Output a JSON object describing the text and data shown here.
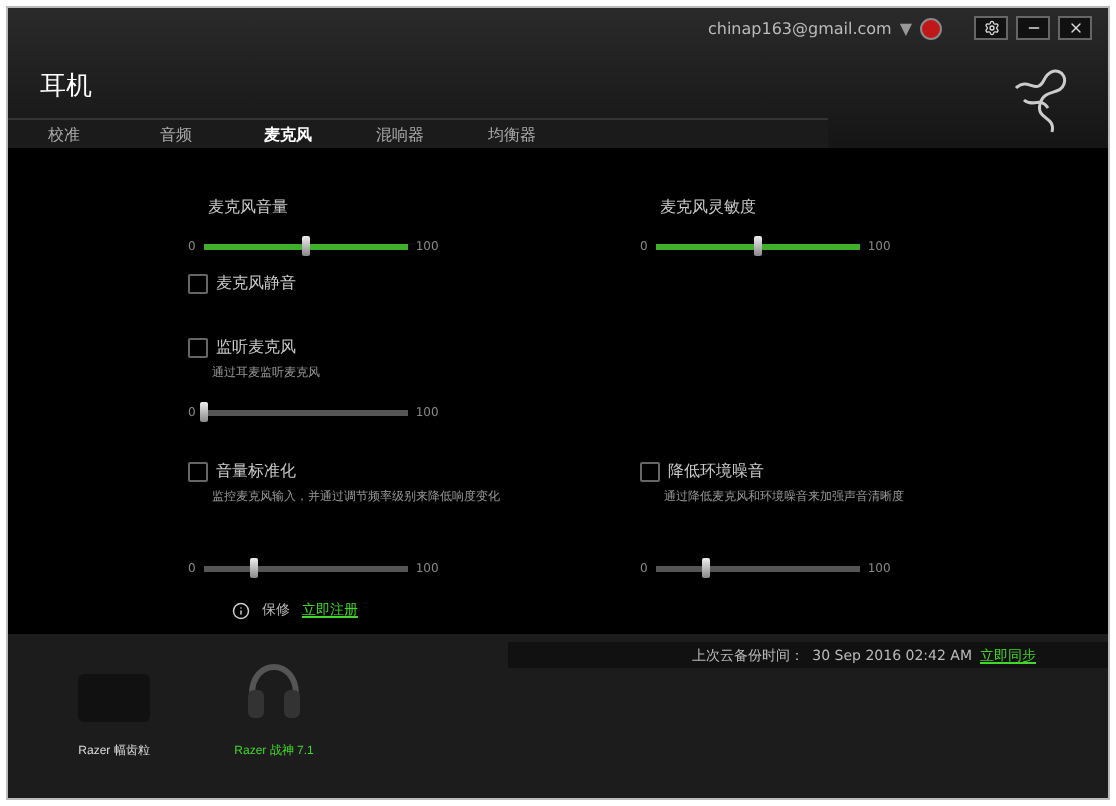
{
  "account": {
    "email": "chinap163@gmail.com",
    "dropdown": "▼"
  },
  "window": {
    "title": "耳机"
  },
  "tabs": [
    {
      "label": "校准",
      "selected": false
    },
    {
      "label": "音频",
      "selected": false
    },
    {
      "label": "麦克风",
      "selected": true
    },
    {
      "label": "混响器",
      "selected": false
    },
    {
      "label": "均衡器",
      "selected": false
    }
  ],
  "rows": [
    {
      "left": {
        "kind": "slider",
        "label": "麦克风音量",
        "slider": {
          "level": 0.5,
          "min": "0",
          "max": "100",
          "enabled": true
        }
      },
      "right": {
        "kind": "slider",
        "label": "麦克风灵敏度",
        "slider": {
          "level": 0.5,
          "min": "0",
          "max": "100",
          "enabled": true
        }
      }
    },
    {
      "left": {
        "kind": "checkbox",
        "label": "麦克风静音",
        "checked": false
      }
    },
    {
      "left": {
        "kind": "checkbox",
        "label": "监听麦克风",
        "checked": false,
        "description": "通过耳麦监听麦克风",
        "slider": {
          "level": 0,
          "min": "0",
          "max": "100",
          "enabled": false
        }
      }
    },
    {
      "left": {
        "kind": "checkbox",
        "label": "音量标准化",
        "checked": false,
        "description": "监控麦克风输入，并通过调节频率级别来降低响度变化",
        "slider": {
          "level": 0.25,
          "min": "0",
          "max": "100",
          "enabled": false
        }
      },
      "right": {
        "kind": "checkbox",
        "label": "降低环境噪音",
        "checked": false,
        "description": "通过降低麦克风和环境噪音来加强声音清晰度",
        "slider": {
          "level": 0.25,
          "min": "0",
          "max": "100",
          "enabled": false
        }
      }
    }
  ],
  "footer": {
    "warranty": "保修",
    "register_link": "立即注册"
  },
  "sync": {
    "label": "上次云备份时间：",
    "time": "30 Sep 2016 02:42 AM",
    "sync_link": "立即同步"
  },
  "devices": [
    {
      "kind": "mousepad",
      "name": "Razer 幅齿粒",
      "selected": false
    },
    {
      "kind": "headset",
      "name": "Razer 战神 7.1",
      "selected": true
    }
  ]
}
